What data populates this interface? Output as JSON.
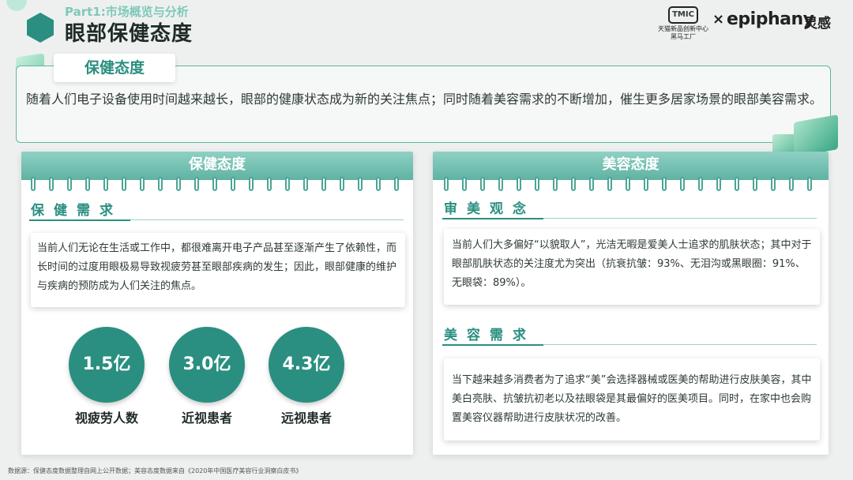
{
  "header": {
    "part": "Part1:市场概览与分析",
    "title": "眼部保健态度",
    "logo_tmall": "TMIC",
    "logo_tmall_sub": "天猫新品创新中心 黑马工厂",
    "logo_x": "×",
    "logo_epiphany": "epiphany",
    "logo_ling": "灵感"
  },
  "intro": {
    "tab": "保健态度",
    "text": "随着人们电子设备使用时间越来越长，眼部的健康状态成为新的关注焦点；同时随着美容需求的不断增加，催生更多居家场景的眼部美容需求。"
  },
  "left_card": {
    "title": "保健态度",
    "section": "保健需求",
    "text": "当前人们无论在生活或工作中，都很难离开电子产品甚至逐渐产生了依赖性，而长时间的过度用眼极易导致视疲劳甚至眼部疾病的发生；因此，眼部健康的维护与疾病的预防成为人们关注的焦点。",
    "stats": [
      {
        "value": "1.5亿",
        "label": "视疲劳人数"
      },
      {
        "value": "3.0亿",
        "label": "近视患者"
      },
      {
        "value": "4.3亿",
        "label": "远视患者"
      }
    ]
  },
  "right_card": {
    "title": "美容态度",
    "section1": "审美观念",
    "text1": "当前人们大多偏好“以貌取人”，光洁无暇是爱美人士追求的肌肤状态；其中对于眼部肌肤状态的关注度尤为突出（抗衰抗皱：93%、无泪沟或黑眼圈：91%、无眼袋：89%）。",
    "section2": "美容需求",
    "text2": "当下越来越多消费者为了追求“美”会选择器械或医美的帮助进行皮肤美容，其中美白亮肤、抗皱抗初老以及祛眼袋是其最偏好的医美项目。同时，在家中也会购置美容仪器帮助进行皮肤状况的改善。"
  },
  "footnote": "数据源：保健态度数据整理自网上公开数据；美容态度数据来自《2020年中国医疗美容行业洞察白皮书》",
  "colors": {
    "accent": "#2a8f80",
    "light_accent": "#8fd1c4"
  }
}
